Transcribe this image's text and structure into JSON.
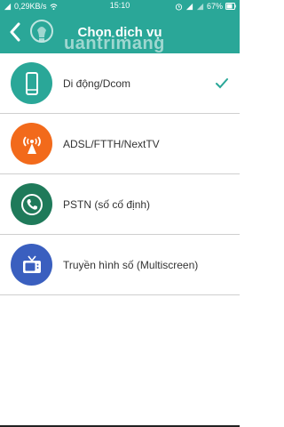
{
  "status_bar": {
    "data_rate": "0,29KB/s",
    "time": "15:10",
    "battery": "67%"
  },
  "header": {
    "title": "Chọn dịch vụ",
    "watermark": "uantrimang"
  },
  "services": [
    {
      "label": "Di động/Dcom",
      "icon": "mobile-phone-icon",
      "color": "#2aa798",
      "selected": true
    },
    {
      "label": "ADSL/FTTH/NextTV",
      "icon": "antenna-icon",
      "color": "#f26a1b",
      "selected": false
    },
    {
      "label": "PSTN (số cố định)",
      "icon": "landline-phone-icon",
      "color": "#1f7a5a",
      "selected": false
    },
    {
      "label": "Truyền hình số (Multiscreen)",
      "icon": "tv-icon",
      "color": "#3a5fbf",
      "selected": false
    }
  ],
  "colors": {
    "accent": "#2aa798",
    "check": "#2aa798"
  }
}
